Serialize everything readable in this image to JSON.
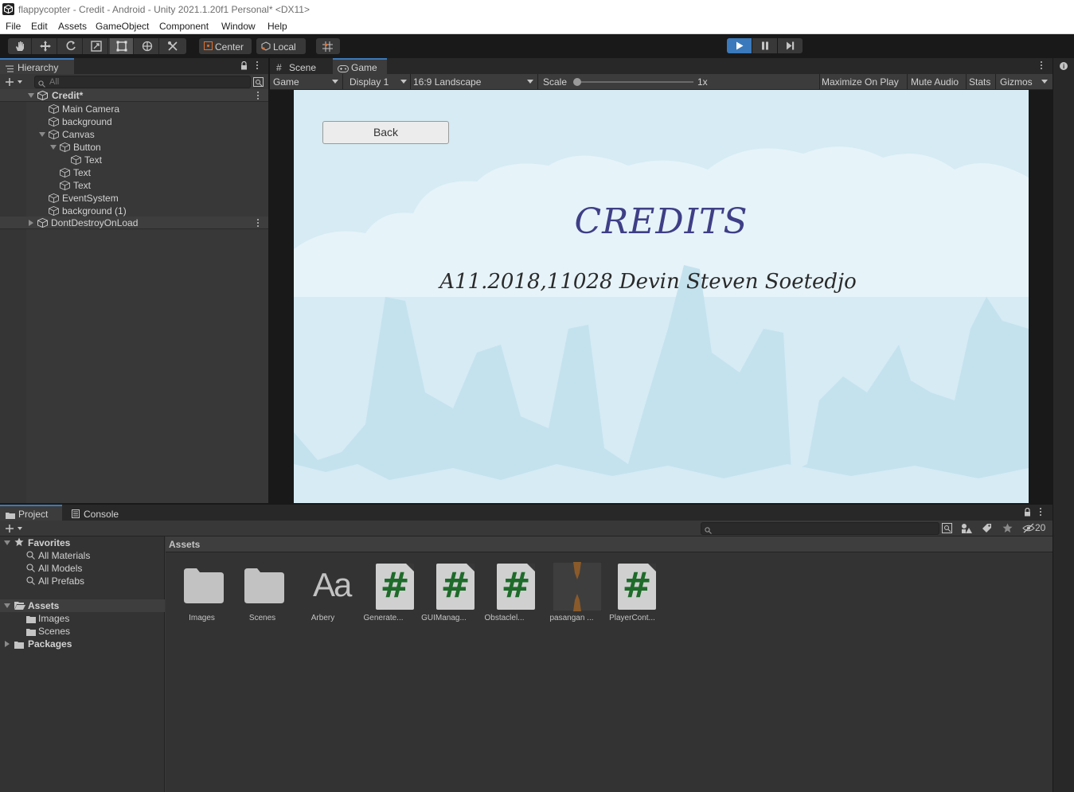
{
  "window": {
    "title": "flappycopter - Credit - Android - Unity 2021.1.20f1 Personal* <DX11>"
  },
  "menu": [
    "File",
    "Edit",
    "Assets",
    "GameObject",
    "Component",
    "Window",
    "Help"
  ],
  "toolbar": {
    "pivot_label": "Center",
    "space_label": "Local",
    "play_state": "playing"
  },
  "hierarchy": {
    "tab_label": "Hierarchy",
    "search_placeholder": "All",
    "items": [
      {
        "label": "Credit*",
        "kind": "scene",
        "expanded": true
      },
      {
        "label": "Main Camera",
        "kind": "object"
      },
      {
        "label": "background",
        "kind": "object"
      },
      {
        "label": "Canvas",
        "kind": "object",
        "expanded": true
      },
      {
        "label": "Button",
        "kind": "object",
        "expanded": true
      },
      {
        "label": "Text",
        "kind": "object"
      },
      {
        "label": "Text",
        "kind": "object"
      },
      {
        "label": "Text",
        "kind": "object"
      },
      {
        "label": "EventSystem",
        "kind": "object"
      },
      {
        "label": "background (1)",
        "kind": "object"
      },
      {
        "label": "DontDestroyOnLoad",
        "kind": "scene",
        "expanded": false
      }
    ]
  },
  "game_view": {
    "tabs": [
      "Scene",
      "Game"
    ],
    "active_tab": "Game",
    "mode": "Game",
    "display": "Display 1",
    "aspect": "16:9 Landscape",
    "scale_label": "Scale",
    "scale_value": "1x",
    "maximize_label": "Maximize On Play",
    "mute_label": "Mute Audio",
    "stats_label": "Stats",
    "gizmos_label": "Gizmos",
    "content": {
      "back_button": "Back",
      "title": "CREDITS",
      "credit_line": "A11.2018,11028 Devin Steven Soetedjo"
    },
    "colors": {
      "sky": "#d6ebf4",
      "cloud": "#e6f3f9",
      "mountain": "#c4e2ee",
      "title": "#3e3f86"
    }
  },
  "project": {
    "tabs": [
      "Project",
      "Console"
    ],
    "active_tab": "Project",
    "hidden_count": "20",
    "favorites_label": "Favorites",
    "favorites": [
      "All Materials",
      "All Models",
      "All Prefabs"
    ],
    "assets_label": "Assets",
    "asset_folders": [
      "Images",
      "Scenes"
    ],
    "packages_label": "Packages",
    "breadcrumb": "Assets",
    "assets": [
      {
        "label": "Images",
        "type": "folder"
      },
      {
        "label": "Scenes",
        "type": "folder"
      },
      {
        "label": "Arbery",
        "type": "font"
      },
      {
        "label": "Generate...",
        "type": "script"
      },
      {
        "label": "GUIManag...",
        "type": "script"
      },
      {
        "label": "Obstaclel...",
        "type": "script"
      },
      {
        "label": "pasangan ...",
        "type": "sprite"
      },
      {
        "label": "PlayerCont...",
        "type": "script"
      }
    ]
  },
  "accent": "#3a79bb"
}
